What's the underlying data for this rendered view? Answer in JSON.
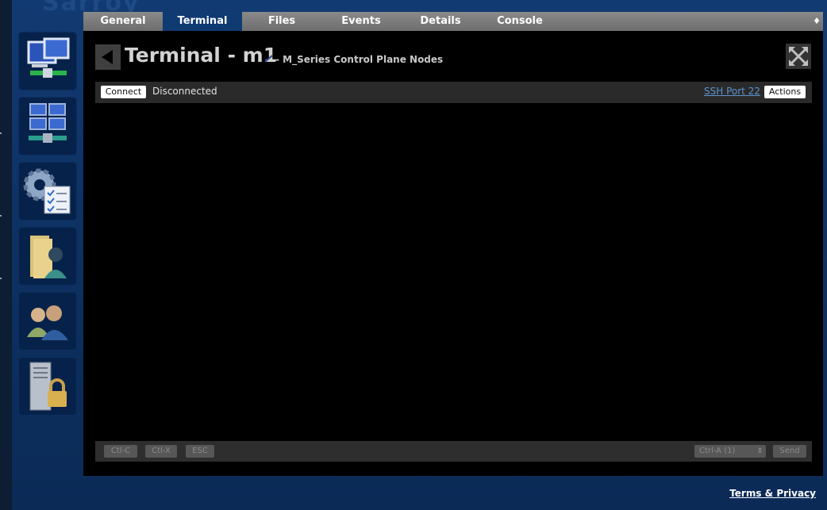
{
  "header": {
    "logo_text": "Sarroy"
  },
  "tabs": [
    {
      "label": "General",
      "active": false
    },
    {
      "label": "Terminal",
      "active": true
    },
    {
      "label": "Files",
      "active": false
    },
    {
      "label": "Events",
      "active": false
    },
    {
      "label": "Details",
      "active": false
    },
    {
      "label": "Console",
      "active": false
    }
  ],
  "tab_menu_glyph": "♦",
  "sidebar": {
    "items": [
      {
        "icon": "network-computers-icon"
      },
      {
        "icon": "device-group-icon"
      },
      {
        "icon": "settings-checklist-icon"
      },
      {
        "icon": "user-folder-icon"
      },
      {
        "icon": "users-icon"
      },
      {
        "icon": "server-lock-icon"
      }
    ]
  },
  "page": {
    "title": "Terminal - m1",
    "subtitle": "- M_Series Control Plane Nodes"
  },
  "toolbar": {
    "connect_label": "Connect",
    "status": "Disconnected",
    "ssh_link": "SSH Port 22",
    "actions_label": "Actions"
  },
  "bottom": {
    "ctrl_c": "Ctl-C",
    "ctrl_x": "Ctl-X",
    "esc": "ESC",
    "select_value": "Ctrl-A (1)",
    "send": "Send"
  },
  "footer": {
    "terms": "Terms & Privacy"
  },
  "colors": {
    "background": "#0b2b57",
    "tab_active": "#0f3a72",
    "link": "#5b93cd"
  }
}
